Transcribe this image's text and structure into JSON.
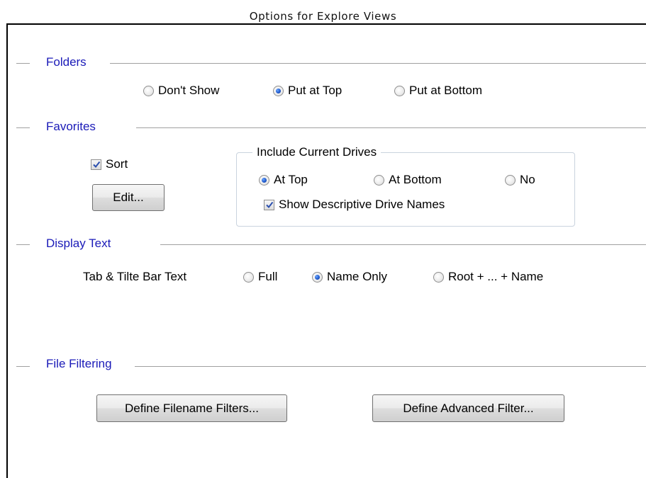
{
  "window": {
    "title": "Options for Explore Views"
  },
  "folders": {
    "label": "Folders",
    "options": [
      "Don't Show",
      "Put at Top",
      "Put at Bottom"
    ],
    "selected": "Put at Top"
  },
  "favorites": {
    "label": "Favorites",
    "sort_label": "Sort",
    "sort_checked": true,
    "edit_button": "Edit...",
    "include_drives": {
      "label": "Include Current Drives",
      "options": [
        "At Top",
        "At Bottom",
        "No"
      ],
      "selected": "At Top",
      "descriptive_label": "Show Descriptive Drive Names",
      "descriptive_checked": true
    }
  },
  "display_text": {
    "label": "Display Text",
    "tab_bar_label": "Tab & Tilte Bar Text",
    "options": [
      "Full",
      "Name Only",
      "Root + ... + Name"
    ],
    "selected": "Name Only"
  },
  "file_filtering": {
    "label": "File Filtering",
    "filename_filters_button": "Define Filename Filters...",
    "advanced_filter_button": "Define Advanced Filter..."
  },
  "colors": {
    "group_label": "#1a1ab8",
    "radio_selected": "#1d56c9"
  }
}
